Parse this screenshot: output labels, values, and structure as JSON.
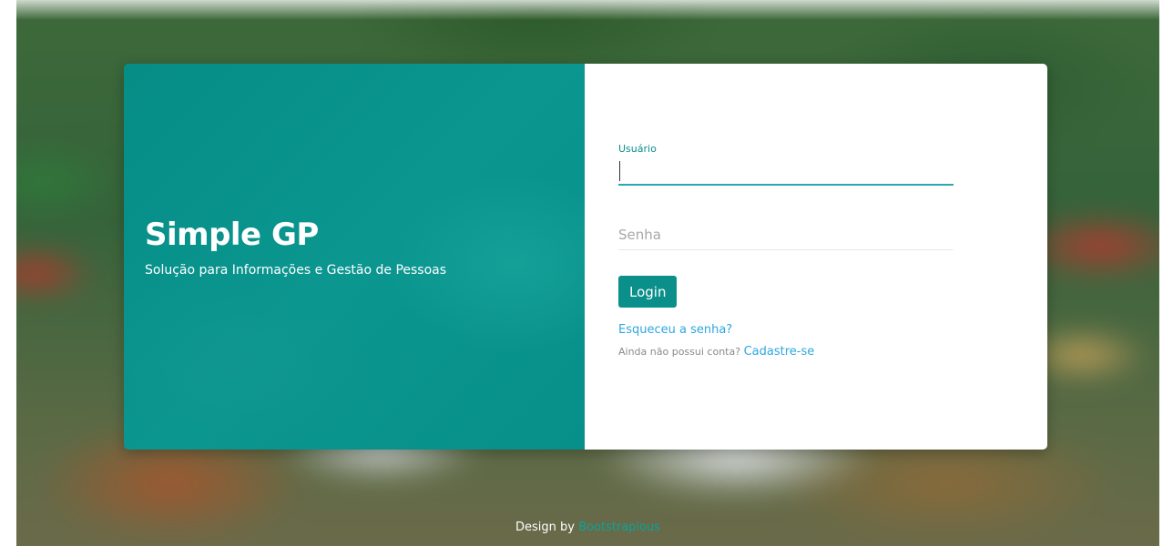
{
  "brand": {
    "title": "Simple GP",
    "subtitle": "Solução para Informações e Gestão de Pessoas"
  },
  "form": {
    "username": {
      "label": "Usuário",
      "value": ""
    },
    "password": {
      "placeholder": "Senha",
      "value": ""
    },
    "login_button": "Login",
    "forgot_link": "Esqueceu a senha?",
    "no_account_text": "Ainda não possui conta?",
    "signup_link": "Cadastre-se"
  },
  "footer": {
    "prefix": "Design by",
    "link": "Bootstrapious"
  },
  "colors": {
    "brand_teal": "#0a8f8a",
    "link_blue": "#2ea7e0",
    "input_focus_border": "#2ea7b0"
  }
}
